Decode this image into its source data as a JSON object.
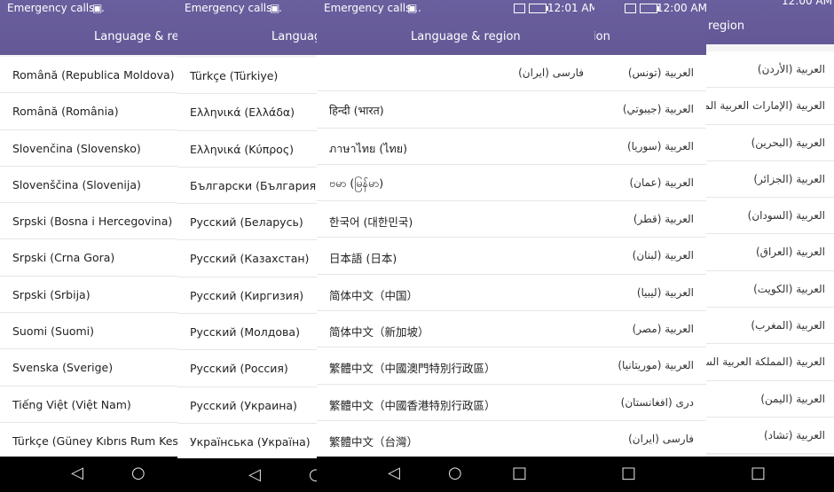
{
  "status": {
    "emergency": "Emergency calls...",
    "time_a": "12:01 AM",
    "time_b": "12:00 AM",
    "time_c": "12:00 AM"
  },
  "title_full": "Language & region",
  "title_cut1": "Language & regio",
  "title_cut2": "Language",
  "title_cut3": "ion",
  "title_cut4": "region",
  "panel1": [
    "Română (Republica Moldova)",
    "Română (România)",
    "Slovenčina (Slovensko)",
    "Slovenščina (Slovenija)",
    "Srpski (Bosna i Hercegovina)",
    "Srpski (Crna Gora)",
    "Srpski (Srbija)",
    "Suomi (Suomi)",
    "Svenska (Sverige)",
    "Tiếng Việt (Việt Nam)",
    "Türkçe (Güney Kıbrıs Rum Kesimi)"
  ],
  "panel2": [
    "Türkçe (Türkiye)",
    "Ελληνικά (Ελλάδα)",
    "Ελληνικά (Κύπρος)",
    "Български (България)",
    "Русский (Беларусь)",
    "Русский (Казахстан)",
    "Русский (Киргизия)",
    "Русский (Молдова)",
    "Русский (Россия)",
    "Русский (Украина)",
    "Українська (Україна)"
  ],
  "panel3_left": [
    "فارسی (ایران)",
    "हिन्दी (भारत)",
    "ภาษาไทย (ไทย)",
    "ဗမာ (မြန်မာ)",
    "한국어 (대한민국)",
    "日本語 (日本)",
    "简体中文（中国）",
    "简体中文（新加坡）",
    "繁體中文（中國澳門特別行政區）",
    "繁體中文（中國香港特別行政區）",
    "繁體中文（台灣）"
  ],
  "panel4": [
    "العربية (تونس)",
    "العربية (جيبوتي)",
    "العربية (سوريا)",
    "العربية (عمان)",
    "العربية (قطر)",
    "العربية (لبنان)",
    "العربية (ليبيا)",
    "العربية (مصر)",
    "العربية (موريتانيا)",
    "درى (افغانستان)",
    "فارسی (ایران)"
  ],
  "panel5": [
    "العربية (الأردن)",
    "العربية (الإمارات العربية المتحدة)",
    "العربية (البحرين)",
    "العربية (الجزائر)",
    "العربية (السودان)",
    "العربية (العراق)",
    "العربية (الكويت)",
    "العربية (المغرب)",
    "العربية (المملكة العربية السعودية)",
    "العربية (اليمن)",
    "العربية (تشاد)"
  ]
}
